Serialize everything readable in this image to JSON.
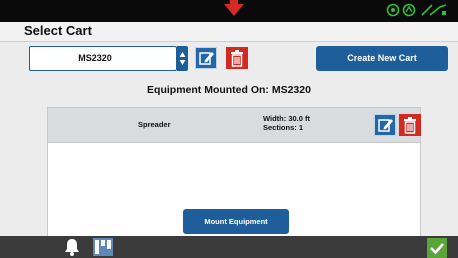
{
  "title": "Select Cart",
  "cart_selector": {
    "value": "MS2320"
  },
  "buttons": {
    "create_new_cart": "Create New Cart",
    "mount_equipment": "Mount Equipment"
  },
  "mounted_header": "Equipment Mounted On: MS2320",
  "equipment": [
    {
      "name": "Spreader",
      "width": "Width: 30.0 ft",
      "sections": "Sections: 1"
    }
  ],
  "icons": {
    "status": [
      "gps-icon",
      "signal-icon",
      "connectivity-icon"
    ],
    "row_actions": [
      "edit-icon",
      "trash-icon"
    ],
    "bottom": [
      "bell-icon",
      "map-icon",
      "checkmark-icon"
    ],
    "pointer": "down-arrow-icon"
  },
  "colors": {
    "accent_blue": "#1e5e9a",
    "delete_red": "#d02a22",
    "confirm_green": "#5ba43a",
    "status_green": "#2fbf3a"
  }
}
